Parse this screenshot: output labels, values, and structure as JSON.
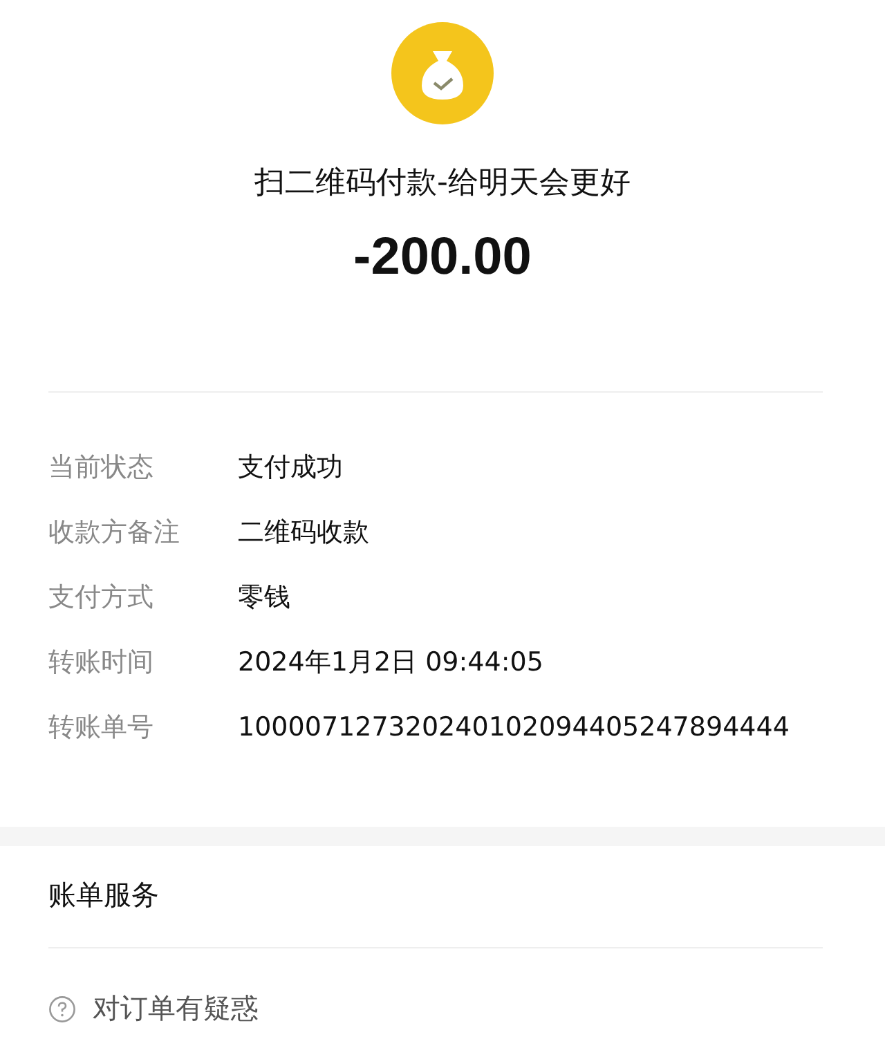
{
  "payment": {
    "title": "扫二维码付款-给明天会更好",
    "amount": "-200.00"
  },
  "details": [
    {
      "label": "当前状态",
      "value": "支付成功"
    },
    {
      "label": "收款方备注",
      "value": "二维码收款"
    },
    {
      "label": "支付方式",
      "value": "零钱"
    },
    {
      "label": "转账时间",
      "value": "2024年1月2日 09:44:05"
    },
    {
      "label": "转账单号",
      "value": "100007127320240102094405247894444"
    }
  ],
  "services": {
    "title": "账单服务",
    "items": [
      {
        "label": "对订单有疑惑"
      }
    ]
  }
}
